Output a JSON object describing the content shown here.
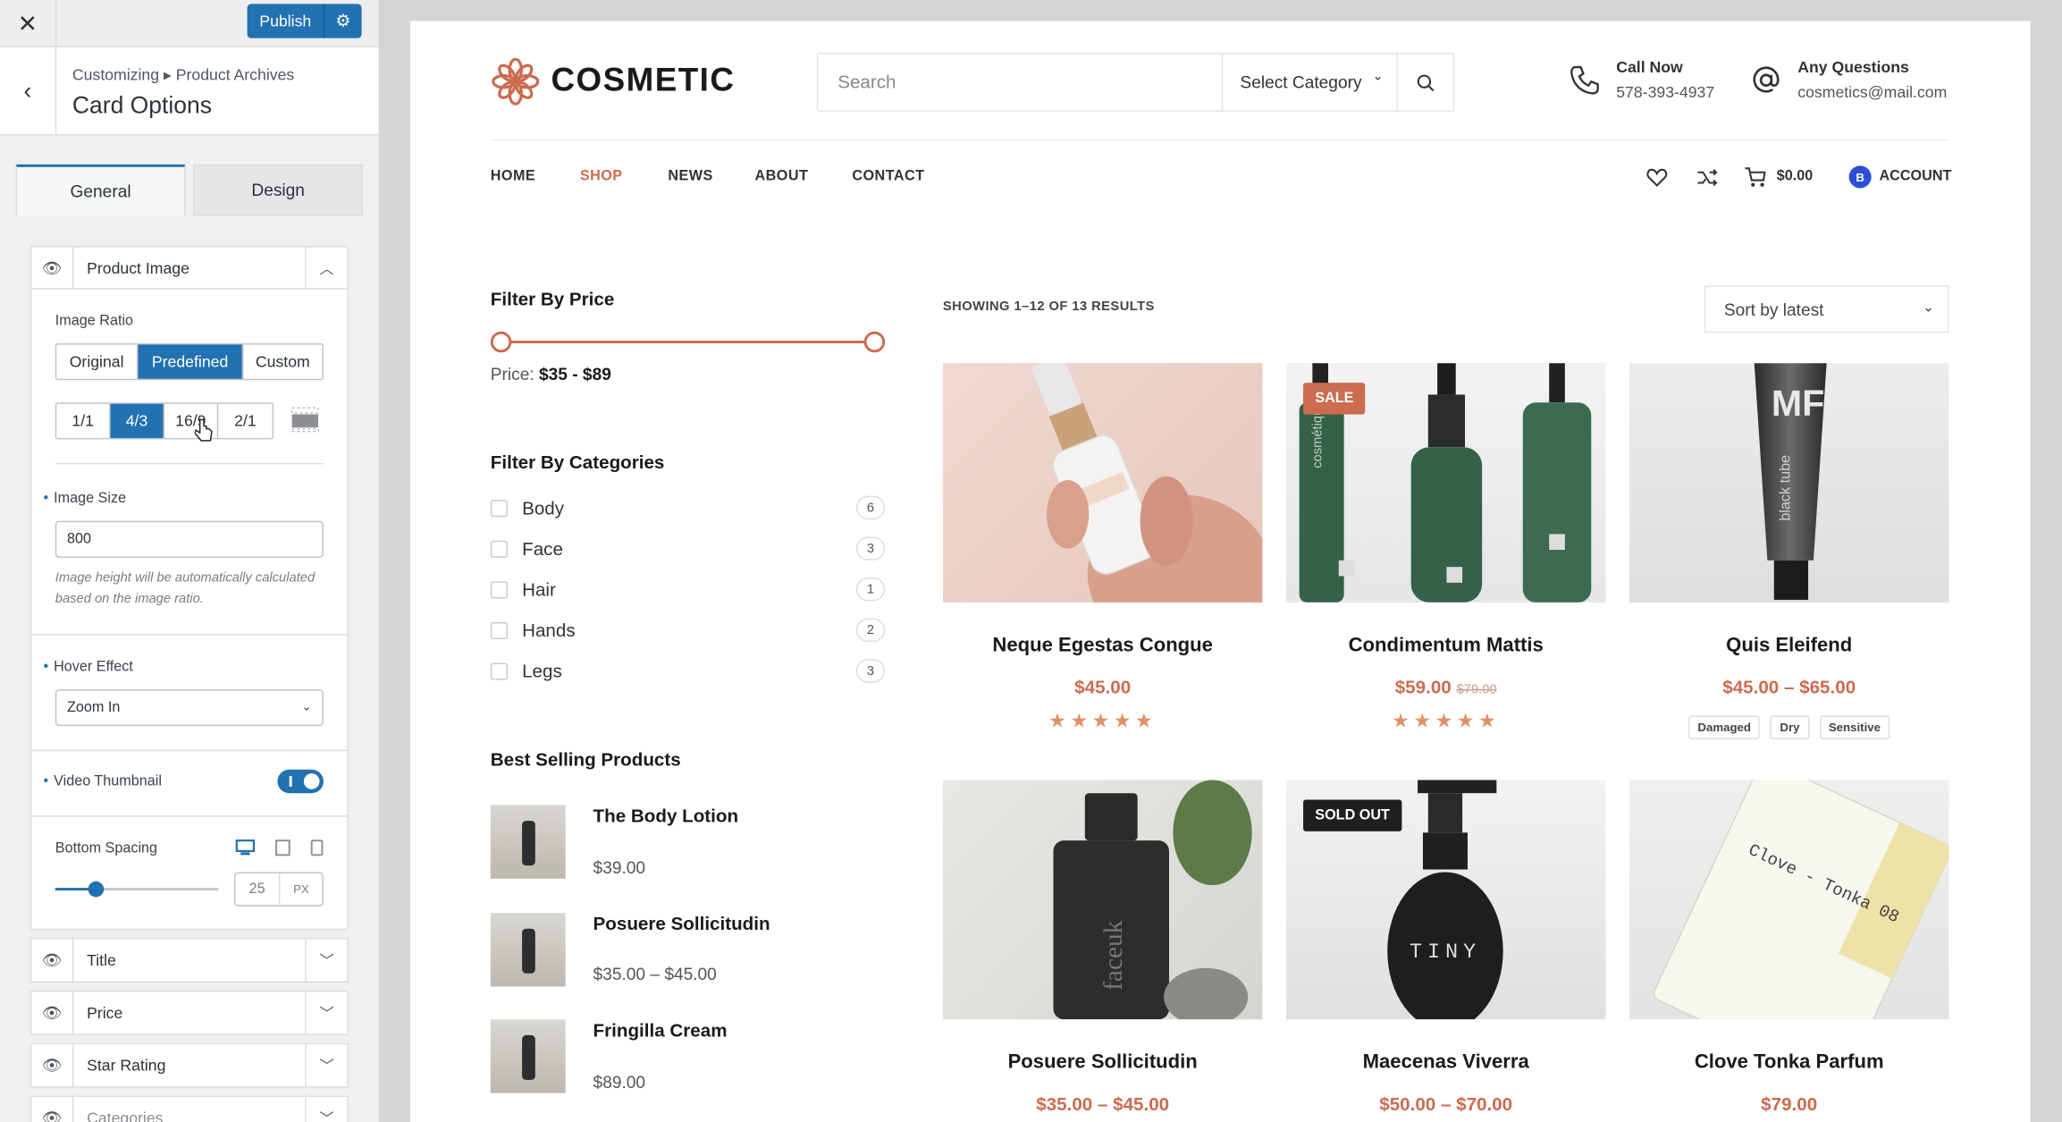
{
  "customizer": {
    "close_icon": "close-icon",
    "publish_label": "Publish",
    "breadcrumb": "Customizing ▸ Product Archives",
    "title": "Card Options",
    "tabs": [
      "General",
      "Design"
    ],
    "product_image": {
      "section_title": "Product Image",
      "ratio_label": "Image Ratio",
      "ratio_modes": [
        "Original",
        "Predefined",
        "Custom"
      ],
      "ratio_mode_selected": "Predefined",
      "ratios": [
        "1/1",
        "4/3",
        "16/9",
        "2/1"
      ],
      "ratio_selected": "4/3",
      "size_label": "Image Size",
      "size_value": "800",
      "size_help": "Image height will be automatically calculated based on the image ratio.",
      "hover_label": "Hover Effect",
      "hover_value": "Zoom In",
      "video_label": "Video Thumbnail",
      "video_enabled": true,
      "spacing_label": "Bottom Spacing",
      "spacing_value": "25",
      "spacing_unit": "PX",
      "spacing_fraction": 0.25
    },
    "collapsed_sections": [
      "Title",
      "Price",
      "Star Rating",
      "Categories"
    ]
  },
  "site": {
    "logo": "COSMETIC",
    "search_placeholder": "Search",
    "category_select": "Select Category",
    "call_label": "Call Now",
    "call_value": "578-393-4937",
    "questions_label": "Any Questions",
    "questions_value": "cosmetics@mail.com",
    "nav": [
      "HOME",
      "SHOP",
      "NEWS",
      "ABOUT",
      "CONTACT"
    ],
    "nav_active": "SHOP",
    "cart_total": "$0.00",
    "account_initial": "B",
    "account_label": "ACCOUNT",
    "accent_color": "#cc6b4f",
    "filter_price": {
      "title": "Filter By Price",
      "label": "Price:",
      "range": "$35 - $89"
    },
    "filter_categories": {
      "title": "Filter By Categories",
      "items": [
        {
          "name": "Body",
          "count": "6"
        },
        {
          "name": "Face",
          "count": "3"
        },
        {
          "name": "Hair",
          "count": "1"
        },
        {
          "name": "Hands",
          "count": "2"
        },
        {
          "name": "Legs",
          "count": "3"
        }
      ]
    },
    "best_selling": {
      "title": "Best Selling Products",
      "items": [
        {
          "name": "The Body Lotion",
          "price": "$39.00"
        },
        {
          "name": "Posuere Sollicitudin",
          "price": "$35.00 – $45.00"
        },
        {
          "name": "Fringilla Cream",
          "price": "$89.00"
        }
      ]
    },
    "showing": "SHOWING 1–12 OF 13 RESULTS",
    "sort": "Sort by latest",
    "products": [
      {
        "name": "Neque Egestas Congue",
        "price": "$45.00",
        "old_price": "",
        "badge": "",
        "rating": 5,
        "tags": []
      },
      {
        "name": "Condimentum Mattis",
        "price": "$59.00",
        "old_price": "$79.00",
        "badge": "SALE",
        "rating": 5,
        "tags": []
      },
      {
        "name": "Quis Eleifend",
        "price": "$45.00 – $65.00",
        "old_price": "",
        "badge": "",
        "rating": 0,
        "tags": [
          "Damaged",
          "Dry",
          "Sensitive"
        ]
      },
      {
        "name": "Posuere Sollicitudin",
        "price": "$35.00 – $45.00",
        "old_price": "",
        "badge": "",
        "rating": 0,
        "tags": []
      },
      {
        "name": "Maecenas Viverra",
        "price": "$50.00 – $70.00",
        "old_price": "",
        "badge": "SOLD OUT",
        "rating": 0,
        "tags": []
      },
      {
        "name": "Clove Tonka Parfum",
        "price": "$79.00",
        "old_price": "",
        "badge": "",
        "rating": 0,
        "tags": []
      }
    ],
    "product_labels": {
      "tube_logo": "MF",
      "tube_text": "black tube",
      "green_bottle_text": "cosmétiques",
      "dark_bottle_text": "faceuk",
      "pump_bottle_text": "TINY",
      "perfume_text": "Clove - Tonka 08"
    }
  }
}
